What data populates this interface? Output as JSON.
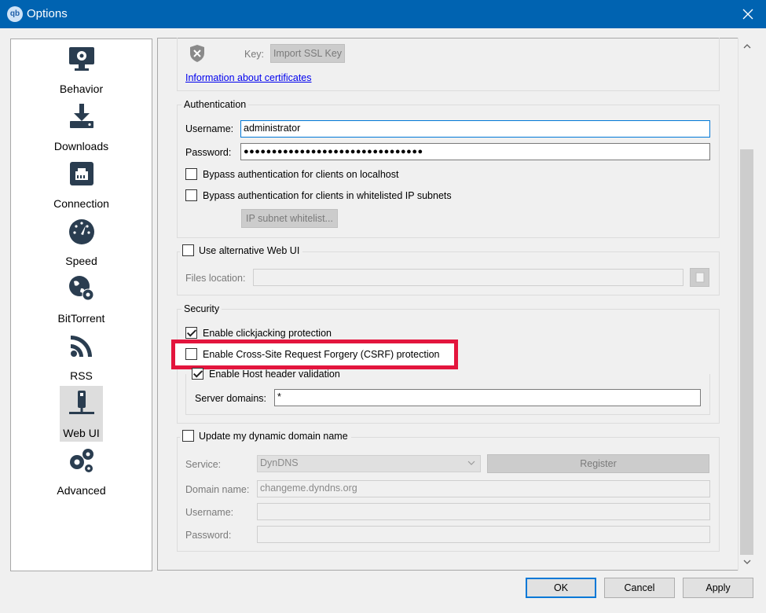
{
  "window": {
    "title": "Options",
    "app_icon_text": "qb",
    "close_icon": "close-icon"
  },
  "sidebar": {
    "items": [
      {
        "label": "Behavior",
        "icon": "monitor-gear-icon"
      },
      {
        "label": "Downloads",
        "icon": "download-icon"
      },
      {
        "label": "Connection",
        "icon": "network-port-icon"
      },
      {
        "label": "Speed",
        "icon": "speedometer-icon"
      },
      {
        "label": "BitTorrent",
        "icon": "globe-gear-icon"
      },
      {
        "label": "RSS",
        "icon": "rss-icon"
      },
      {
        "label": "Web UI",
        "icon": "web-ui-icon",
        "selected": true
      },
      {
        "label": "Advanced",
        "icon": "gears-icon"
      }
    ]
  },
  "https": {
    "key_label": "Key:",
    "import_key_button": "Import SSL Key",
    "info_link": "Information about certificates"
  },
  "authentication": {
    "title": "Authentication",
    "username_label": "Username:",
    "username_value": "administrator",
    "password_label": "Password:",
    "password_value": "●●●●●●●●●●●●●●●●●●●●●●●●●●●●●●●●",
    "bypass_localhost": "Bypass authentication for clients on localhost",
    "bypass_whitelist": "Bypass authentication for clients in whitelisted IP subnets",
    "whitelist_button": "IP subnet whitelist..."
  },
  "alt_webui": {
    "checkbox_label": "Use alternative Web UI",
    "files_location_label": "Files location:",
    "files_location_value": ""
  },
  "security": {
    "title": "Security",
    "clickjacking": "Enable clickjacking protection",
    "csrf": "Enable Cross-Site Request Forgery (CSRF) protection",
    "host_header": "Enable Host header validation",
    "server_domains_label": "Server domains:",
    "server_domains_value": "*"
  },
  "ddns": {
    "checkbox_label": "Update my dynamic domain name",
    "service_label": "Service:",
    "service_value": "DynDNS",
    "register_button": "Register",
    "domain_label": "Domain name:",
    "domain_value": "changeme.dyndns.org",
    "username_label": "Username:",
    "username_value": "",
    "password_label": "Password:",
    "password_value": ""
  },
  "footer": {
    "ok": "OK",
    "cancel": "Cancel",
    "apply": "Apply"
  },
  "colors": {
    "titlebar": "#0063b1",
    "highlight": "#e3153d",
    "link": "#0000ee"
  }
}
